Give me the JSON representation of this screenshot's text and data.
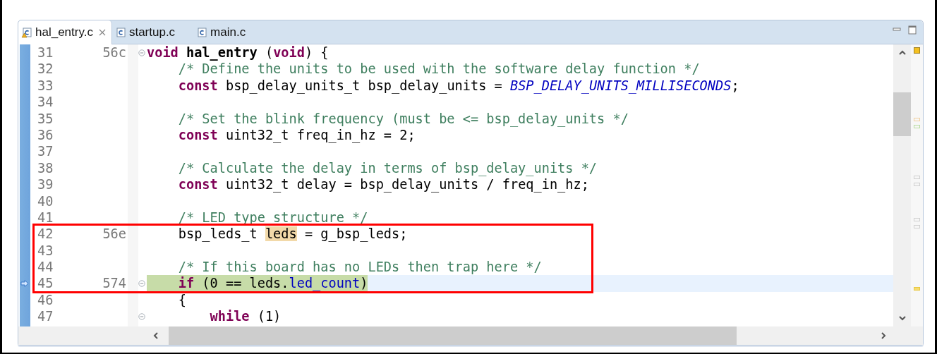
{
  "tabs": [
    {
      "label": "hal_entry.c",
      "selected": true,
      "warning": true,
      "closable": true
    },
    {
      "label": "startup.c",
      "selected": false,
      "warning": false,
      "closable": false
    },
    {
      "label": "main.c",
      "selected": false,
      "warning": false,
      "closable": false
    }
  ],
  "blocks": [
    {
      "boxed": false,
      "lines": [
        {
          "number": "31",
          "address": "56c",
          "kind": "top",
          "fold": true,
          "current": false,
          "tokens": [
            {
              "kind": "kw",
              "text": "void"
            },
            {
              "kind": "bold",
              "text": " hal_entry"
            },
            {
              "kind": "plain",
              "text": " ("
            },
            {
              "kind": "kw",
              "text": "void"
            },
            {
              "kind": "plain",
              "text": ") {"
            }
          ]
        },
        {
          "number": "32",
          "kind": "body",
          "fold": false,
          "current": false,
          "tokens": [
            {
              "kind": "comment",
              "text": "/* Define the units to be used with the software delay function */"
            }
          ]
        },
        {
          "number": "33",
          "kind": "body",
          "fold": false,
          "current": false,
          "tokens": [
            {
              "kind": "kw",
              "text": "const"
            },
            {
              "kind": "plain",
              "text": " bsp_delay_units_t bsp_delay_units = "
            },
            {
              "kind": "const",
              "text": "BSP_DELAY_UNITS_MILLISECONDS"
            },
            {
              "kind": "plain",
              "text": ";"
            }
          ]
        },
        {
          "number": "34",
          "fold": false,
          "current": false
        },
        {
          "number": "35",
          "kind": "body",
          "fold": false,
          "current": false,
          "tokens": [
            {
              "kind": "comment",
              "text": "/* Set the blink frequency (must be <= bsp_delay_units */"
            }
          ]
        },
        {
          "number": "36",
          "kind": "body",
          "fold": false,
          "current": false,
          "tokens": [
            {
              "kind": "kw",
              "text": "const"
            },
            {
              "kind": "plain",
              "text": " uint32_t freq_in_hz = 2;"
            }
          ]
        },
        {
          "number": "37",
          "fold": false,
          "current": false
        },
        {
          "number": "38",
          "kind": "body",
          "fold": false,
          "current": false,
          "tokens": [
            {
              "kind": "comment",
              "text": "/* Calculate the delay in terms of bsp_delay_units */"
            }
          ]
        },
        {
          "number": "39",
          "kind": "body",
          "fold": false,
          "current": false,
          "tokens": [
            {
              "kind": "kw",
              "text": "const"
            },
            {
              "kind": "plain",
              "text": " uint32_t delay = bsp_delay_units / freq_in_hz;"
            }
          ]
        },
        {
          "number": "40",
          "fold": false,
          "current": false
        },
        {
          "number": "41",
          "kind": "body",
          "fold": false,
          "current": false,
          "tokens": [
            {
              "kind": "comment",
              "text": "/* LED type structure */"
            }
          ]
        }
      ]
    },
    {
      "boxed": true,
      "lines": [
        {
          "number": "42",
          "address": "56e",
          "kind": "body",
          "fold": false,
          "current": false,
          "tokens": [
            {
              "kind": "plain",
              "text": "bsp_leds_t "
            },
            {
              "kind": "occurrence",
              "text": "leds"
            },
            {
              "kind": "plain",
              "text": " = g_bsp_leds;"
            }
          ]
        },
        {
          "number": "43",
          "fold": false,
          "current": false
        },
        {
          "number": "44",
          "kind": "body",
          "fold": false,
          "current": false,
          "tokens": [
            {
              "kind": "comment",
              "text": "/* If this board has no LEDs then trap here */"
            }
          ]
        },
        {
          "number": "45",
          "address": "574",
          "kind": "body",
          "fold": true,
          "current": true,
          "tokens": [
            {
              "kind": "kw",
              "text": "if"
            },
            {
              "kind": "plain",
              "text": " (0 == leds."
            },
            {
              "kind": "field",
              "text": "led_count"
            },
            {
              "kind": "plain",
              "text": ")"
            }
          ]
        }
      ]
    },
    {
      "boxed": false,
      "lines": [
        {
          "number": "46",
          "kind": "body",
          "fold": false,
          "current": false,
          "tokens": [
            {
              "kind": "plain",
              "text": "{"
            }
          ]
        },
        {
          "number": "47",
          "kind": "inner",
          "fold": true,
          "current": false,
          "tokens": [
            {
              "kind": "kw",
              "text": "while"
            },
            {
              "kind": "plain",
              "text": " (1)"
            }
          ]
        }
      ]
    }
  ]
}
